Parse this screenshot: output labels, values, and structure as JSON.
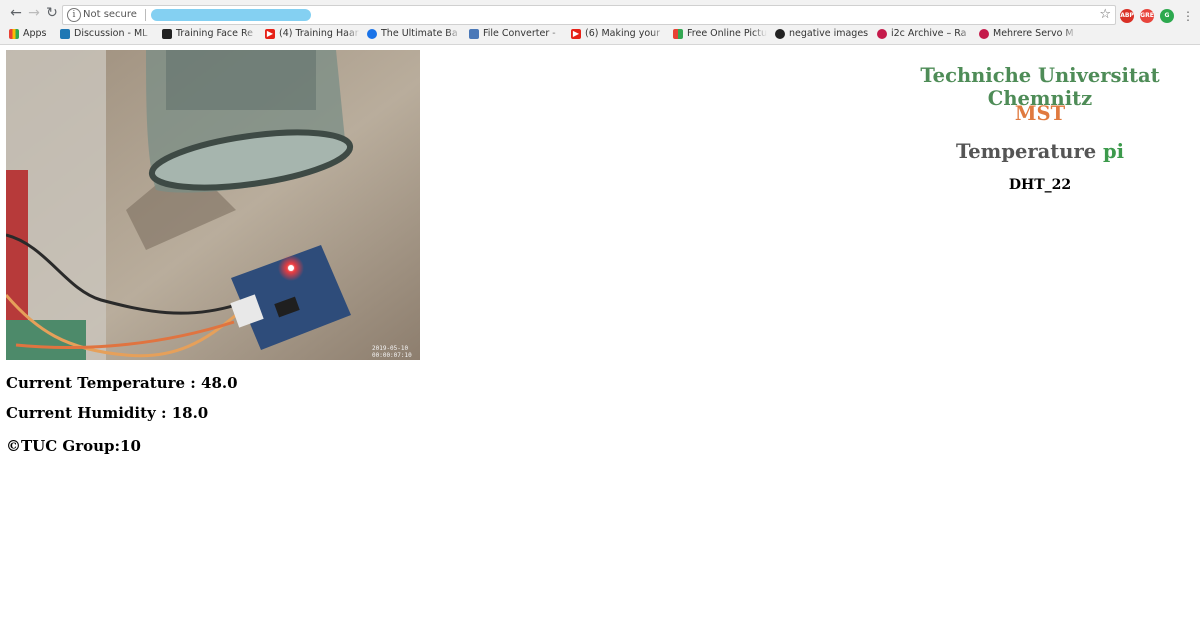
{
  "browser": {
    "security_text": "Not secure",
    "bookmarks": [
      {
        "label": "Apps",
        "icon": "apps-grid-icon"
      },
      {
        "label": "Discussion - ML",
        "icon": "kaggle-icon"
      },
      {
        "label": "Training Face Re",
        "icon": "document-icon"
      },
      {
        "label": "(4) Training Haar",
        "icon": "youtube-icon"
      },
      {
        "label": "The Ultimate Ba",
        "icon": "globe-icon"
      },
      {
        "label": "File Converter -",
        "icon": "file-converter-icon"
      },
      {
        "label": "(6) Making your",
        "icon": "youtube-icon"
      },
      {
        "label": "Free Online Pictu",
        "icon": "grid-image-icon"
      },
      {
        "label": "negative images",
        "icon": "github-icon"
      },
      {
        "label": "i2c Archive – Ra",
        "icon": "raspberry-icon"
      },
      {
        "label": "Mehrere Servo M",
        "icon": "raspberry-icon"
      }
    ]
  },
  "header": {
    "university": "Techniche Universitat Chemnitz",
    "department": "MST",
    "project_prefix": "Temperature",
    "project_suffix": "pi",
    "sensor": "DHT_22"
  },
  "camera": {
    "timestamp_line1": "2019-05-10",
    "timestamp_line2": "00:00:07:10"
  },
  "readings": {
    "temperature_label": "Current Temperature : 48.0",
    "humidity_label": "Current Humidity : 18.0"
  },
  "footer": {
    "copyright": "©TUC Group:10"
  },
  "colors": {
    "university": "#4e8c57",
    "department": "#e07a3f",
    "project_prefix": "#555555",
    "project_suffix": "#3c9a4c"
  }
}
